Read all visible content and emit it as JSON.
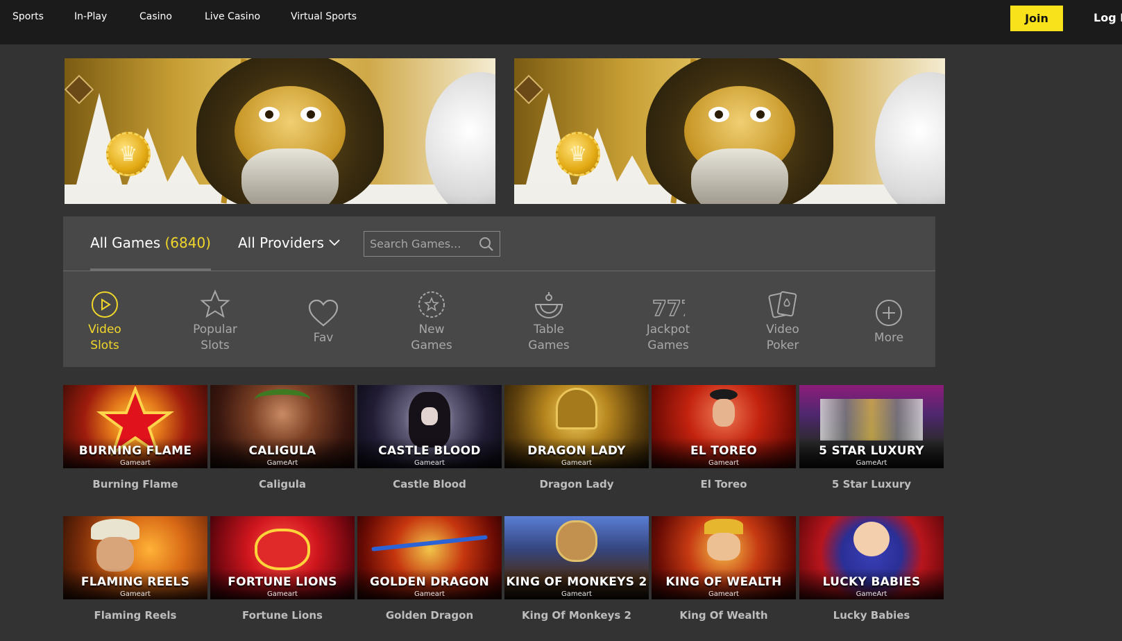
{
  "nav": {
    "items": [
      {
        "label": "Sports"
      },
      {
        "label": "In-Play"
      },
      {
        "label": "Casino"
      },
      {
        "label": "Live Casino"
      },
      {
        "label": "Virtual Sports"
      }
    ],
    "join_label": "Join",
    "login_label": "Log In"
  },
  "games_panel": {
    "all_games_label": "All Games",
    "all_games_count": "(6840)",
    "providers_label": "All Providers",
    "search_placeholder": "Search Games...",
    "categories": [
      {
        "label": "Video\nSlots",
        "icon": "play-circle-icon",
        "active": true
      },
      {
        "label": "Popular\nSlots",
        "icon": "star-icon",
        "active": false
      },
      {
        "label": "Fav",
        "icon": "heart-icon",
        "active": false
      },
      {
        "label": "New\nGames",
        "icon": "new-badge-icon",
        "active": false
      },
      {
        "label": "Table\nGames",
        "icon": "roulette-icon",
        "active": false
      },
      {
        "label": "Jackpot\nGames",
        "icon": "sevens-icon",
        "active": false
      },
      {
        "label": "Video\nPoker",
        "icon": "cards-icon",
        "active": false
      },
      {
        "label": "More",
        "icon": "plus-circle-icon",
        "active": false
      }
    ],
    "accent_color": "#f2d72b"
  },
  "games": [
    {
      "title": "BURNING FLAME",
      "provider": "Gameart",
      "name": "Burning Flame"
    },
    {
      "title": "CALIGULA",
      "provider": "GameArt",
      "name": "Caligula"
    },
    {
      "title": "CASTLE BLOOD",
      "provider": "Gameart",
      "name": "Castle Blood"
    },
    {
      "title": "DRAGON LADY",
      "provider": "Gameart",
      "name": "Dragon Lady"
    },
    {
      "title": "EL TOREO",
      "provider": "Gameart",
      "name": "El Toreo"
    },
    {
      "title": "5 STAR LUXURY",
      "provider": "GameArt",
      "name": "5 Star Luxury"
    },
    {
      "title": "FLAMING REELS",
      "provider": "Gameart",
      "name": "Flaming Reels"
    },
    {
      "title": "FORTUNE LIONS",
      "provider": "Gameart",
      "name": "Fortune Lions"
    },
    {
      "title": "GOLDEN DRAGON",
      "provider": "Gameart",
      "name": "Golden Dragon"
    },
    {
      "title": "KING OF MONKEYS 2",
      "provider": "Gameart",
      "name": "King Of Monkeys 2"
    },
    {
      "title": "KING OF WEALTH",
      "provider": "Gameart",
      "name": "King Of Wealth"
    },
    {
      "title": "LUCKY BABIES",
      "provider": "GameArt",
      "name": "Lucky Babies"
    }
  ]
}
